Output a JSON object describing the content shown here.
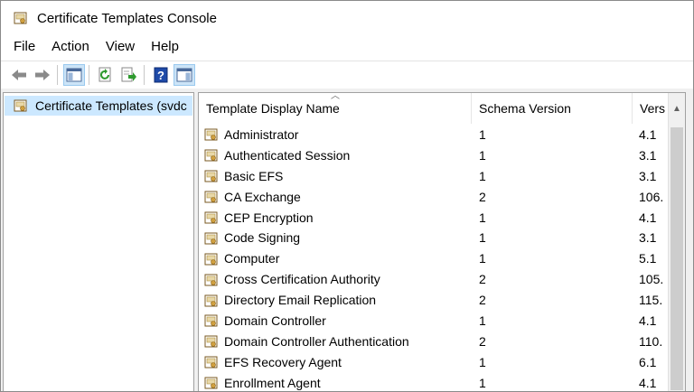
{
  "window": {
    "title": "Certificate Templates Console"
  },
  "menu": [
    "File",
    "Action",
    "View",
    "Help"
  ],
  "toolbar": {
    "icons": [
      "back-arrow-icon",
      "forward-arrow-icon",
      "show-hide-tree-icon",
      "refresh-icon",
      "export-list-icon",
      "help-icon",
      "show-hide-action-pane-icon"
    ]
  },
  "tree": {
    "selected_label": "Certificate Templates (svdc"
  },
  "list": {
    "columns": [
      "Template Display Name",
      "Schema Version",
      "Vers"
    ],
    "sorted_column": "Template Display Name",
    "rows": [
      {
        "name": "Administrator",
        "schema": "1",
        "version": "4.1"
      },
      {
        "name": "Authenticated Session",
        "schema": "1",
        "version": "3.1"
      },
      {
        "name": "Basic EFS",
        "schema": "1",
        "version": "3.1"
      },
      {
        "name": "CA Exchange",
        "schema": "2",
        "version": "106."
      },
      {
        "name": "CEP Encryption",
        "schema": "1",
        "version": "4.1"
      },
      {
        "name": "Code Signing",
        "schema": "1",
        "version": "3.1"
      },
      {
        "name": "Computer",
        "schema": "1",
        "version": "5.1"
      },
      {
        "name": "Cross Certification Authority",
        "schema": "2",
        "version": "105."
      },
      {
        "name": "Directory Email Replication",
        "schema": "2",
        "version": "115."
      },
      {
        "name": "Domain Controller",
        "schema": "1",
        "version": "4.1"
      },
      {
        "name": "Domain Controller Authentication",
        "schema": "2",
        "version": "110."
      },
      {
        "name": "EFS Recovery Agent",
        "schema": "1",
        "version": "6.1"
      },
      {
        "name": "Enrollment Agent",
        "schema": "1",
        "version": "4.1"
      }
    ]
  },
  "colors": {
    "selection": "#cce8ff",
    "toolbar_active": "#cce4f7",
    "pane_border": "#a0a0a0"
  }
}
